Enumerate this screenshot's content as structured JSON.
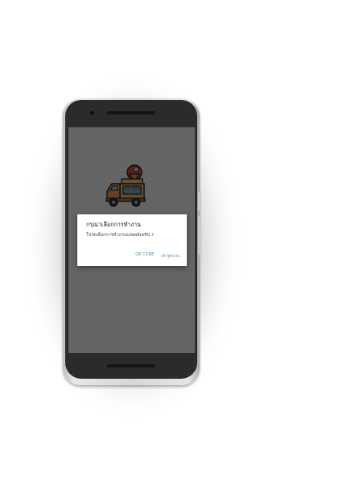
{
  "dialog": {
    "title": "กรุณาเลือกการทำงาน",
    "message": "โปรดเลือกการทำงานแอพพลิเคชัน ?",
    "buttons": {
      "qr_code": "QR CODE",
      "login": "เข้าสู่ระบบ"
    }
  },
  "app": {
    "logo_icon": "food-truck-icon"
  },
  "colors": {
    "accent": "#4a8fa3",
    "scrim": "#616161",
    "phone_body": "#2b2b2b"
  }
}
